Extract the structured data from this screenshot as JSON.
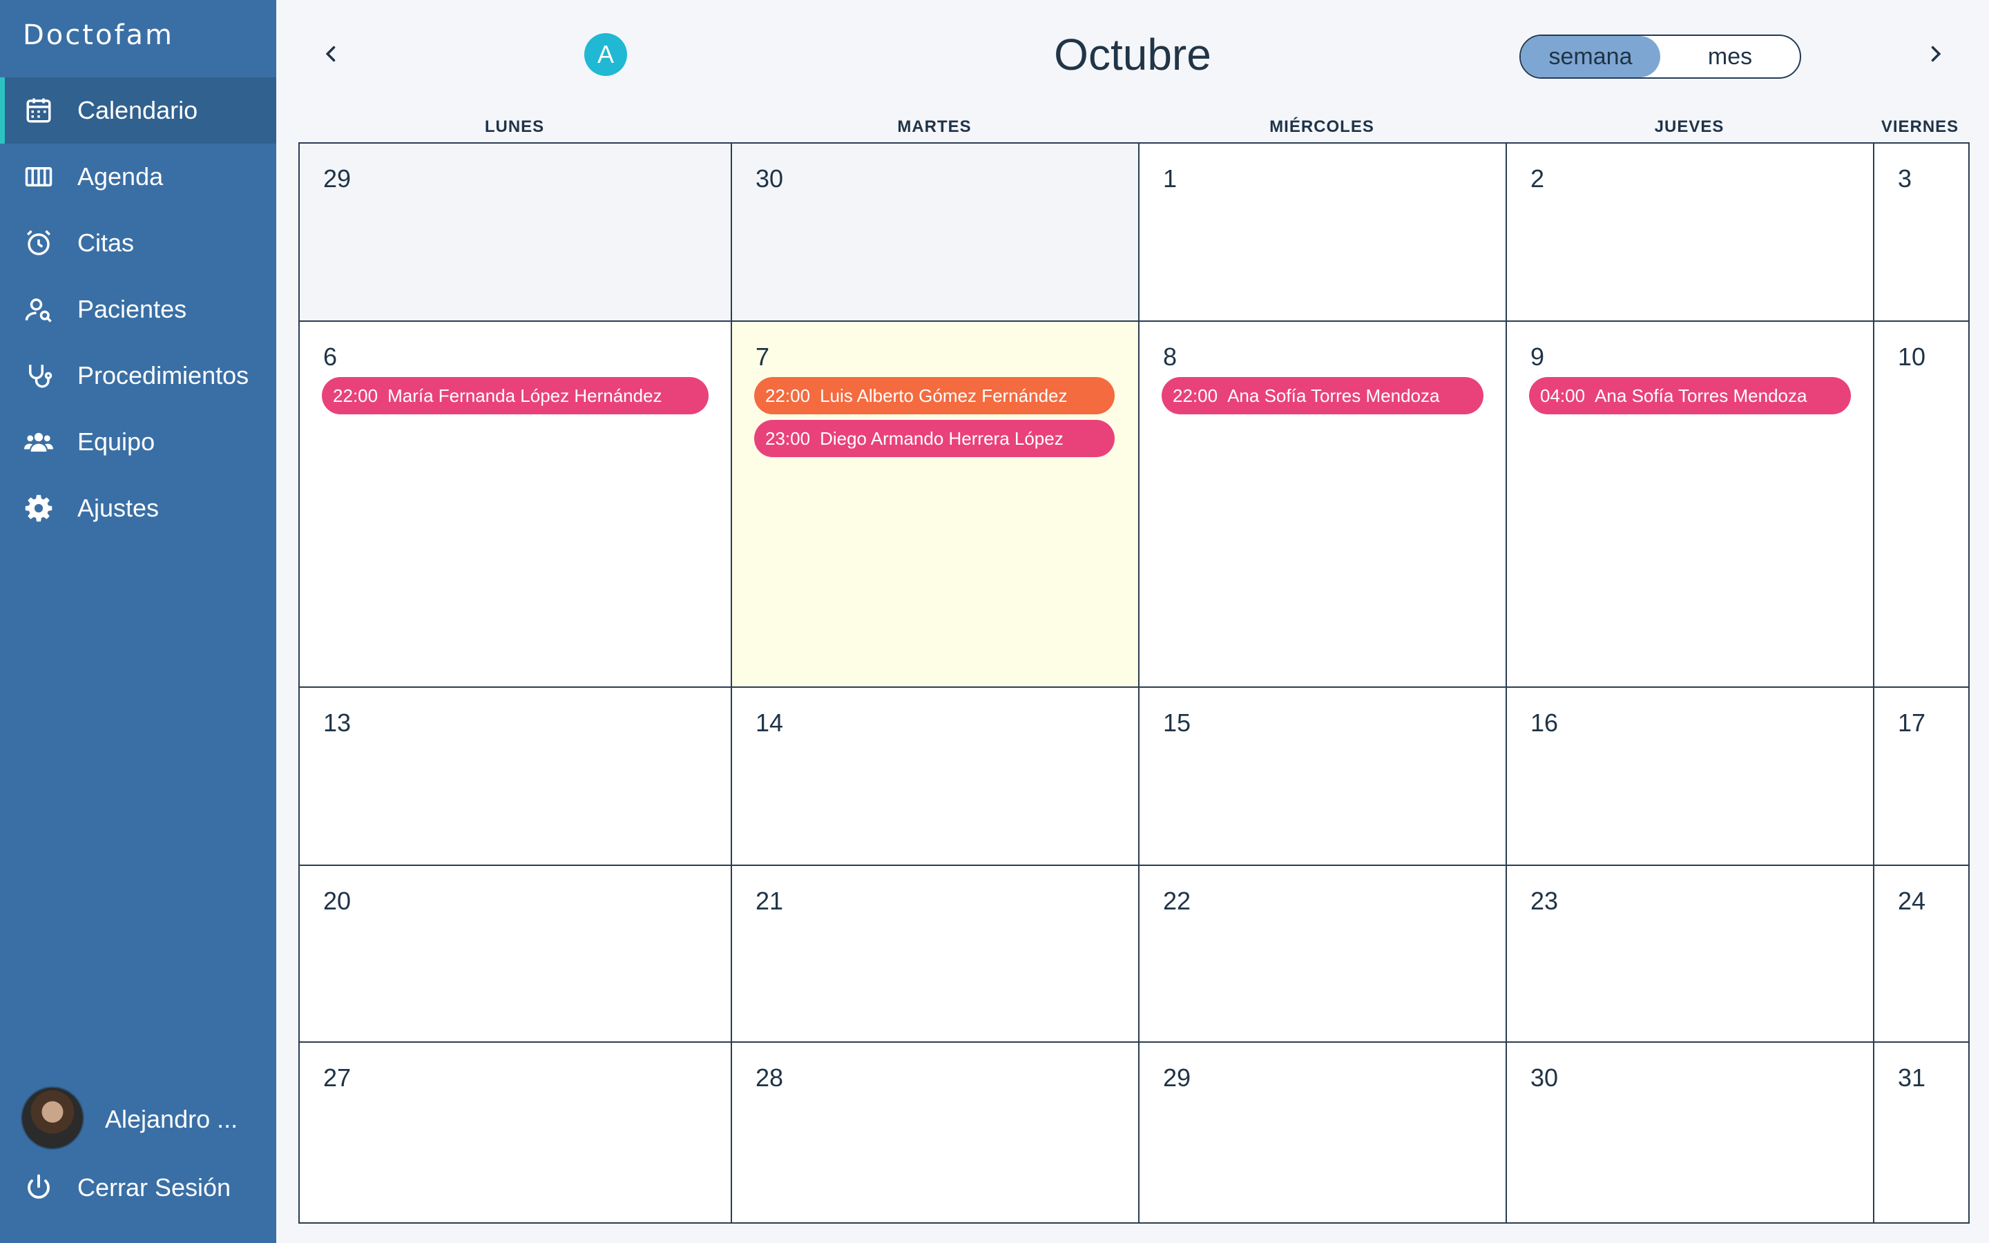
{
  "app": {
    "brand": "Doctofam"
  },
  "sidebar": {
    "items": [
      {
        "label": "Calendario",
        "icon": "calendar-icon"
      },
      {
        "label": "Agenda",
        "icon": "columns-icon"
      },
      {
        "label": "Citas",
        "icon": "alarm-clock-icon"
      },
      {
        "label": "Pacientes",
        "icon": "user-search-icon"
      },
      {
        "label": "Procedimientos",
        "icon": "stethoscope-icon"
      },
      {
        "label": "Equipo",
        "icon": "users-icon"
      },
      {
        "label": "Ajustes",
        "icon": "gear-icon"
      }
    ],
    "active": "Calendario",
    "user_name": "Alejandro ...",
    "logout_label": "Cerrar Sesión"
  },
  "header": {
    "badge": "A",
    "month": "Octubre",
    "view_toggle": {
      "week": "semana",
      "month": "mes",
      "selected": "semana"
    }
  },
  "calendar": {
    "weekdays": [
      "LUNES",
      "MARTES",
      "MIÉRCOLES",
      "JUEVES",
      "VIERNES"
    ],
    "weeks": [
      {
        "days": [
          "29",
          "30",
          "1",
          "2",
          "3"
        ]
      },
      {
        "days": [
          "6",
          "7",
          "8",
          "9",
          "10"
        ]
      },
      {
        "days": [
          "13",
          "14",
          "15",
          "16",
          "17"
        ]
      },
      {
        "days": [
          "20",
          "21",
          "22",
          "23",
          "24"
        ]
      },
      {
        "days": [
          "27",
          "28",
          "29",
          "30",
          "31"
        ]
      }
    ],
    "events": {
      "w1d0": [
        {
          "time": "22:00",
          "name": "María Fernanda López Hernández",
          "color": "#e9427b"
        }
      ],
      "w1d1": [
        {
          "time": "22:00",
          "name": "Luis Alberto Gómez Fernández",
          "color": "#f46b3f"
        },
        {
          "time": "23:00",
          "name": "Diego Armando Herrera López",
          "color": "#e9427b"
        }
      ],
      "w1d2": [
        {
          "time": "22:00",
          "name": "Ana Sofía Torres Mendoza",
          "color": "#e9427b"
        }
      ],
      "w1d3": [
        {
          "time": "04:00",
          "name": "Ana Sofía Torres Mendoza",
          "color": "#e9427b"
        }
      ]
    }
  },
  "colors": {
    "sidebar": "#3a6fa5",
    "active_item": "#30618f",
    "accent": "#2cc3c0",
    "today": "#fefee6"
  }
}
